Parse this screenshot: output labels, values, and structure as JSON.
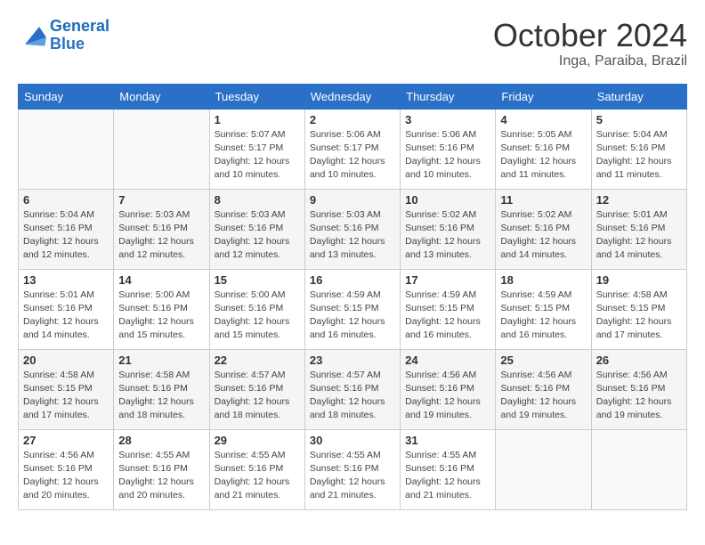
{
  "header": {
    "logo_text_general": "General",
    "logo_text_blue": "Blue",
    "month": "October 2024",
    "location": "Inga, Paraiba, Brazil"
  },
  "weekdays": [
    "Sunday",
    "Monday",
    "Tuesday",
    "Wednesday",
    "Thursday",
    "Friday",
    "Saturday"
  ],
  "weeks": [
    [
      {
        "day": "",
        "info": ""
      },
      {
        "day": "",
        "info": ""
      },
      {
        "day": "1",
        "info": "Sunrise: 5:07 AM\nSunset: 5:17 PM\nDaylight: 12 hours and 10 minutes."
      },
      {
        "day": "2",
        "info": "Sunrise: 5:06 AM\nSunset: 5:17 PM\nDaylight: 12 hours and 10 minutes."
      },
      {
        "day": "3",
        "info": "Sunrise: 5:06 AM\nSunset: 5:16 PM\nDaylight: 12 hours and 10 minutes."
      },
      {
        "day": "4",
        "info": "Sunrise: 5:05 AM\nSunset: 5:16 PM\nDaylight: 12 hours and 11 minutes."
      },
      {
        "day": "5",
        "info": "Sunrise: 5:04 AM\nSunset: 5:16 PM\nDaylight: 12 hours and 11 minutes."
      }
    ],
    [
      {
        "day": "6",
        "info": "Sunrise: 5:04 AM\nSunset: 5:16 PM\nDaylight: 12 hours and 12 minutes."
      },
      {
        "day": "7",
        "info": "Sunrise: 5:03 AM\nSunset: 5:16 PM\nDaylight: 12 hours and 12 minutes."
      },
      {
        "day": "8",
        "info": "Sunrise: 5:03 AM\nSunset: 5:16 PM\nDaylight: 12 hours and 12 minutes."
      },
      {
        "day": "9",
        "info": "Sunrise: 5:03 AM\nSunset: 5:16 PM\nDaylight: 12 hours and 13 minutes."
      },
      {
        "day": "10",
        "info": "Sunrise: 5:02 AM\nSunset: 5:16 PM\nDaylight: 12 hours and 13 minutes."
      },
      {
        "day": "11",
        "info": "Sunrise: 5:02 AM\nSunset: 5:16 PM\nDaylight: 12 hours and 14 minutes."
      },
      {
        "day": "12",
        "info": "Sunrise: 5:01 AM\nSunset: 5:16 PM\nDaylight: 12 hours and 14 minutes."
      }
    ],
    [
      {
        "day": "13",
        "info": "Sunrise: 5:01 AM\nSunset: 5:16 PM\nDaylight: 12 hours and 14 minutes."
      },
      {
        "day": "14",
        "info": "Sunrise: 5:00 AM\nSunset: 5:16 PM\nDaylight: 12 hours and 15 minutes."
      },
      {
        "day": "15",
        "info": "Sunrise: 5:00 AM\nSunset: 5:16 PM\nDaylight: 12 hours and 15 minutes."
      },
      {
        "day": "16",
        "info": "Sunrise: 4:59 AM\nSunset: 5:15 PM\nDaylight: 12 hours and 16 minutes."
      },
      {
        "day": "17",
        "info": "Sunrise: 4:59 AM\nSunset: 5:15 PM\nDaylight: 12 hours and 16 minutes."
      },
      {
        "day": "18",
        "info": "Sunrise: 4:59 AM\nSunset: 5:15 PM\nDaylight: 12 hours and 16 minutes."
      },
      {
        "day": "19",
        "info": "Sunrise: 4:58 AM\nSunset: 5:15 PM\nDaylight: 12 hours and 17 minutes."
      }
    ],
    [
      {
        "day": "20",
        "info": "Sunrise: 4:58 AM\nSunset: 5:15 PM\nDaylight: 12 hours and 17 minutes."
      },
      {
        "day": "21",
        "info": "Sunrise: 4:58 AM\nSunset: 5:16 PM\nDaylight: 12 hours and 18 minutes."
      },
      {
        "day": "22",
        "info": "Sunrise: 4:57 AM\nSunset: 5:16 PM\nDaylight: 12 hours and 18 minutes."
      },
      {
        "day": "23",
        "info": "Sunrise: 4:57 AM\nSunset: 5:16 PM\nDaylight: 12 hours and 18 minutes."
      },
      {
        "day": "24",
        "info": "Sunrise: 4:56 AM\nSunset: 5:16 PM\nDaylight: 12 hours and 19 minutes."
      },
      {
        "day": "25",
        "info": "Sunrise: 4:56 AM\nSunset: 5:16 PM\nDaylight: 12 hours and 19 minutes."
      },
      {
        "day": "26",
        "info": "Sunrise: 4:56 AM\nSunset: 5:16 PM\nDaylight: 12 hours and 19 minutes."
      }
    ],
    [
      {
        "day": "27",
        "info": "Sunrise: 4:56 AM\nSunset: 5:16 PM\nDaylight: 12 hours and 20 minutes."
      },
      {
        "day": "28",
        "info": "Sunrise: 4:55 AM\nSunset: 5:16 PM\nDaylight: 12 hours and 20 minutes."
      },
      {
        "day": "29",
        "info": "Sunrise: 4:55 AM\nSunset: 5:16 PM\nDaylight: 12 hours and 21 minutes."
      },
      {
        "day": "30",
        "info": "Sunrise: 4:55 AM\nSunset: 5:16 PM\nDaylight: 12 hours and 21 minutes."
      },
      {
        "day": "31",
        "info": "Sunrise: 4:55 AM\nSunset: 5:16 PM\nDaylight: 12 hours and 21 minutes."
      },
      {
        "day": "",
        "info": ""
      },
      {
        "day": "",
        "info": ""
      }
    ]
  ]
}
